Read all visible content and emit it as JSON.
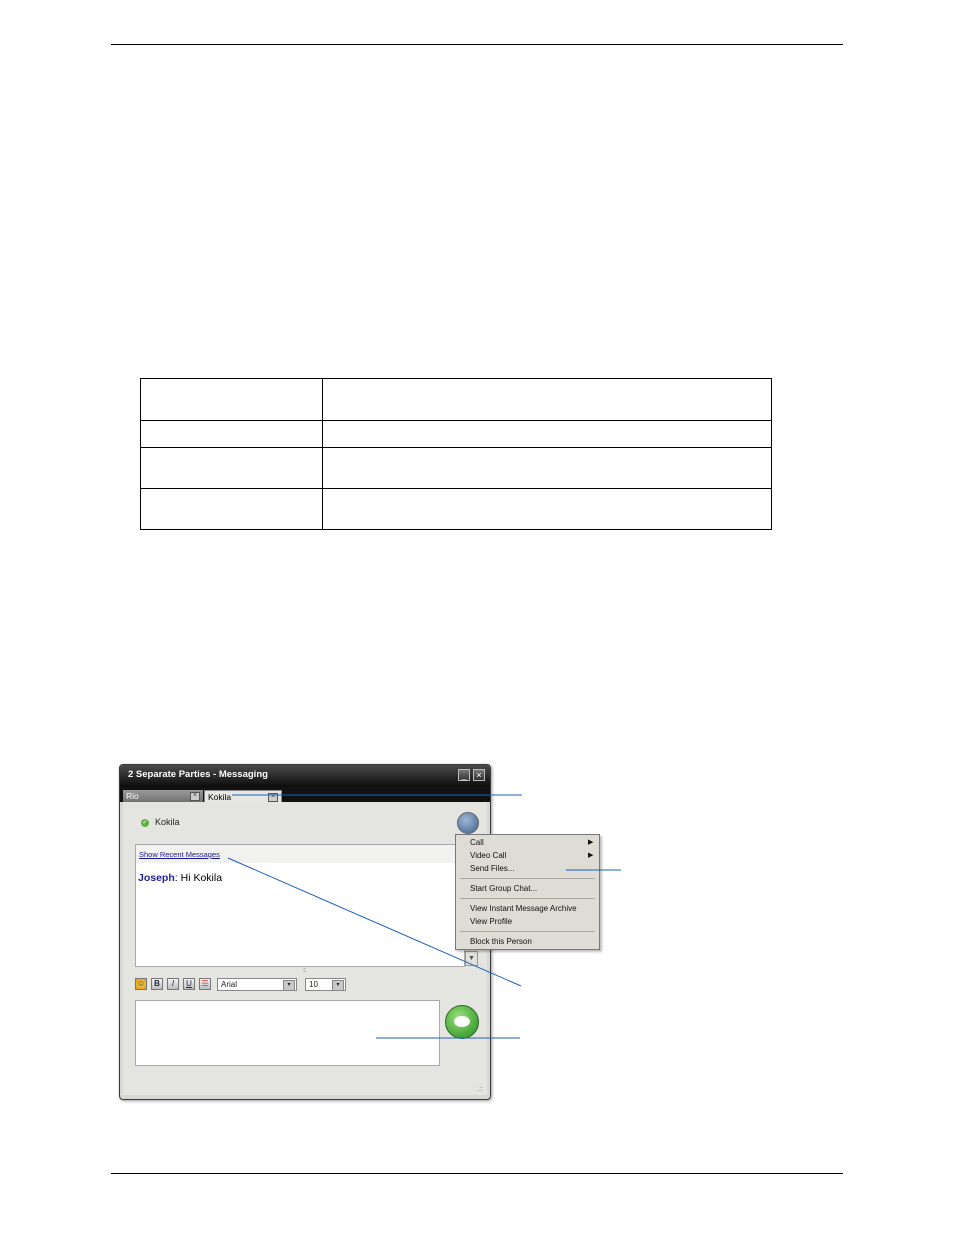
{
  "messaging_window": {
    "title": "2 Separate Parties - Messaging",
    "minimize_glyph": "_",
    "close_glyph": "×",
    "tabs": [
      {
        "label": "Rio",
        "close_glyph": "×"
      },
      {
        "label": "Kokila",
        "close_glyph": "×"
      }
    ],
    "contact": {
      "name": "Kokila",
      "status_icon": "check-circle-icon",
      "status_color": "#5cb03a"
    },
    "show_recent_messages": "Show Recent Messages",
    "conversation": [
      {
        "sender": "Joseph",
        "separator": ":",
        "text": " Hi Kokila"
      }
    ],
    "formatting": {
      "emoticon_label": "☺",
      "bold_label": "B",
      "italic_label": "I",
      "underline_label": "U",
      "color_label": "☰",
      "font": "Arial",
      "size": "10",
      "dropdown_glyph": "▾"
    },
    "scroll_down_glyph": "▼",
    "splitter_glyph": ":::",
    "resize_glyph": ".::"
  },
  "context_menu": {
    "items": {
      "call": "Call",
      "video_call": "Video Call",
      "send_files": "Send Files...",
      "start_group_chat": "Start Group Chat...",
      "view_archive": "View Instant Message Archive",
      "view_profile": "View Profile",
      "block_person": "Block this Person"
    },
    "submenu_glyph": "▶"
  },
  "colors": {
    "callout_line": "#1f5fc0",
    "title_bar": "#1a1a1a",
    "sender_name": "#22229a",
    "send_button": "#2fa52a"
  }
}
